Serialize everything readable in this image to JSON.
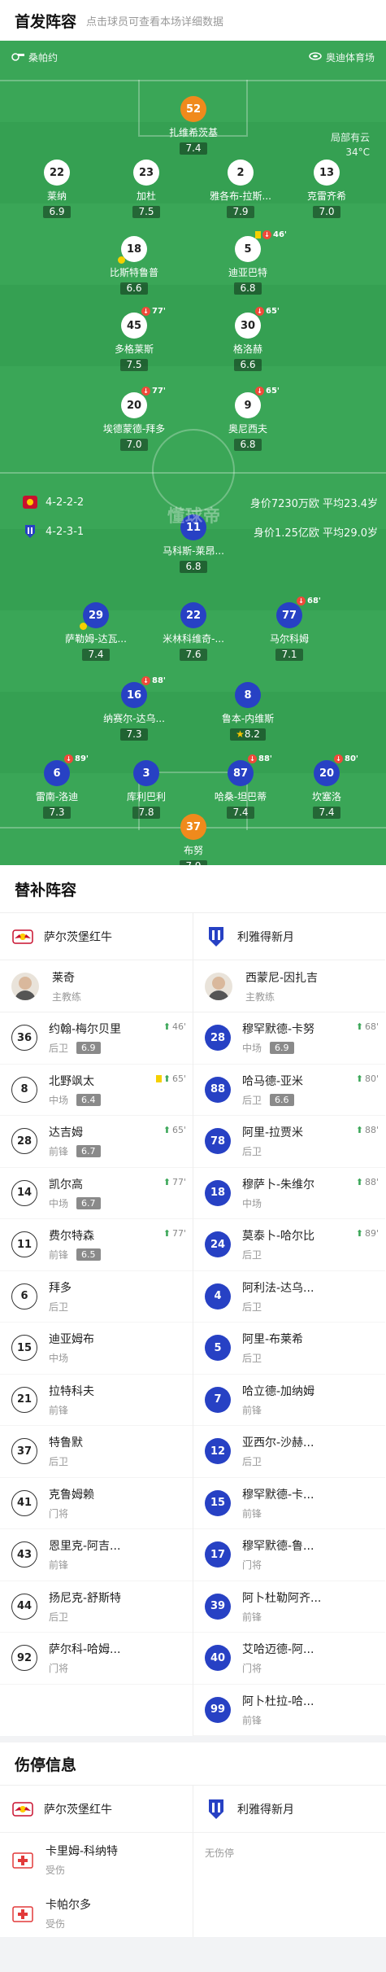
{
  "header": {
    "title": "首发阵容",
    "subtitle": "点击球员可查看本场详细数据"
  },
  "pitch": {
    "home_team": "桑帕约",
    "venue": "奥迪体育场",
    "weather": "局部有云",
    "temperature": "34°C",
    "brand": "懂球帝",
    "home_formation": "4-2-2-2",
    "away_formation": "4-2-3-1",
    "home_value": "身价7230万欧 平均23.4岁",
    "away_value": "身价1.25亿欧 平均29.0岁"
  },
  "home_players": [
    {
      "num": "52",
      "name": "扎维希茨基",
      "rating": "7.4",
      "gk": true
    },
    {
      "num": "22",
      "name": "莱纳",
      "rating": "6.9"
    },
    {
      "num": "23",
      "name": "加杜",
      "rating": "7.5"
    },
    {
      "num": "2",
      "name": "雅各布-拉斯...",
      "rating": "7.9"
    },
    {
      "num": "13",
      "name": "克雷齐希",
      "rating": "7.0"
    },
    {
      "num": "18",
      "name": "比斯特鲁普",
      "rating": "6.6",
      "yellow": true
    },
    {
      "num": "5",
      "name": "迪亚巴特",
      "rating": "6.8",
      "sub": "46'",
      "yellow_card": true
    },
    {
      "num": "45",
      "name": "多格莱斯",
      "rating": "7.5",
      "sub": "77'"
    },
    {
      "num": "30",
      "name": "格洛赫",
      "rating": "6.6",
      "sub": "65'"
    },
    {
      "num": "20",
      "name": "埃德蒙德-拜多",
      "rating": "7.0",
      "sub": "77'"
    },
    {
      "num": "9",
      "name": "奥尼西夫",
      "rating": "6.8",
      "sub": "65'"
    }
  ],
  "away_players": [
    {
      "num": "11",
      "name": "马科斯-莱昂...",
      "rating": "6.8"
    },
    {
      "num": "29",
      "name": "萨勒姆-达瓦...",
      "rating": "7.4",
      "yellow": true
    },
    {
      "num": "22",
      "name": "米林科维奇-...",
      "rating": "7.6"
    },
    {
      "num": "77",
      "name": "马尔科姆",
      "rating": "7.1",
      "sub": "68'"
    },
    {
      "num": "16",
      "name": "纳赛尔-达乌...",
      "rating": "7.3",
      "sub": "88'"
    },
    {
      "num": "8",
      "name": "鲁本-内维斯",
      "rating": "8.2",
      "star": true
    },
    {
      "num": "6",
      "name": "雷南-洛迪",
      "rating": "7.3",
      "sub": "89'"
    },
    {
      "num": "3",
      "name": "库利巴利",
      "rating": "7.8"
    },
    {
      "num": "87",
      "name": "哈桑-坦巴蒂",
      "rating": "7.4",
      "sub": "88'"
    },
    {
      "num": "20",
      "name": "坎塞洛",
      "rating": "7.4",
      "sub": "80'"
    },
    {
      "num": "37",
      "name": "布努",
      "rating": "7.9",
      "gk": true
    }
  ],
  "subs": {
    "title": "替补阵容",
    "home_team": "萨尔茨堡红牛",
    "away_team": "利雅得新月",
    "home_coach": {
      "name": "莱奇",
      "role": "主教练"
    },
    "away_coach": {
      "name": "西蒙尼-因扎吉",
      "role": "主教练"
    },
    "home": [
      {
        "num": "36",
        "name": "约翰-梅尔贝里",
        "pos": "后卫",
        "rating": "6.9",
        "evt": "46'"
      },
      {
        "num": "8",
        "name": "北野飒太",
        "pos": "中场",
        "rating": "6.4",
        "evt": "65'",
        "card": true
      },
      {
        "num": "28",
        "name": "达吉姆",
        "pos": "前锋",
        "rating": "6.7",
        "evt": "65'"
      },
      {
        "num": "14",
        "name": "凯尔高",
        "pos": "中场",
        "rating": "6.7",
        "evt": "77'"
      },
      {
        "num": "11",
        "name": "费尔特森",
        "pos": "前锋",
        "rating": "6.5",
        "evt": "77'"
      },
      {
        "num": "6",
        "name": "拜多",
        "pos": "后卫"
      },
      {
        "num": "15",
        "name": "迪亚姆布",
        "pos": "中场"
      },
      {
        "num": "21",
        "name": "拉特科夫",
        "pos": "前锋"
      },
      {
        "num": "37",
        "name": "特鲁默",
        "pos": "后卫"
      },
      {
        "num": "41",
        "name": "克鲁姆赖",
        "pos": "门将"
      },
      {
        "num": "43",
        "name": "恩里克-阿吉...",
        "pos": "前锋"
      },
      {
        "num": "44",
        "name": "扬尼克-舒斯特",
        "pos": "后卫"
      },
      {
        "num": "92",
        "name": "萨尔科-哈姆...",
        "pos": "门将"
      }
    ],
    "away": [
      {
        "num": "28",
        "name": "穆罕默德-卡努",
        "pos": "中场",
        "rating": "6.9",
        "evt": "68'"
      },
      {
        "num": "88",
        "name": "哈马德-亚米",
        "pos": "后卫",
        "rating": "6.6",
        "evt": "80'"
      },
      {
        "num": "78",
        "name": "阿里-拉贾米",
        "pos": "后卫",
        "evt": "88'"
      },
      {
        "num": "18",
        "name": "穆萨卜-朱维尔",
        "pos": "中场",
        "evt": "88'"
      },
      {
        "num": "24",
        "name": "莫泰卜-哈尔比",
        "pos": "后卫",
        "evt": "89'"
      },
      {
        "num": "4",
        "name": "阿利法-达乌...",
        "pos": "后卫"
      },
      {
        "num": "5",
        "name": "阿里-布莱希",
        "pos": "后卫"
      },
      {
        "num": "7",
        "name": "哈立德-加纳姆",
        "pos": "前锋"
      },
      {
        "num": "12",
        "name": "亚西尔-沙赫...",
        "pos": "后卫"
      },
      {
        "num": "15",
        "name": "穆罕默德-卡...",
        "pos": "前锋"
      },
      {
        "num": "17",
        "name": "穆罕默德-鲁...",
        "pos": "门将"
      },
      {
        "num": "39",
        "name": "阿卜杜勒阿齐...",
        "pos": "前锋"
      },
      {
        "num": "40",
        "name": "艾哈迈德-阿...",
        "pos": "门将"
      },
      {
        "num": "99",
        "name": "阿卜杜拉-哈...",
        "pos": "前锋"
      }
    ]
  },
  "injuries": {
    "title": "伤停信息",
    "home_team": "萨尔茨堡红牛",
    "away_team": "利雅得新月",
    "home": [
      {
        "name": "卡里姆-科纳特",
        "status": "受伤"
      },
      {
        "name": "卡帕尔多",
        "status": "受伤"
      }
    ],
    "away_none": "无伤停"
  },
  "colors": {
    "pitch": "#3aa657",
    "away_disc": "#2741c4",
    "gk_disc": "#f08a1c",
    "sub_badge": "#f04a3a"
  }
}
